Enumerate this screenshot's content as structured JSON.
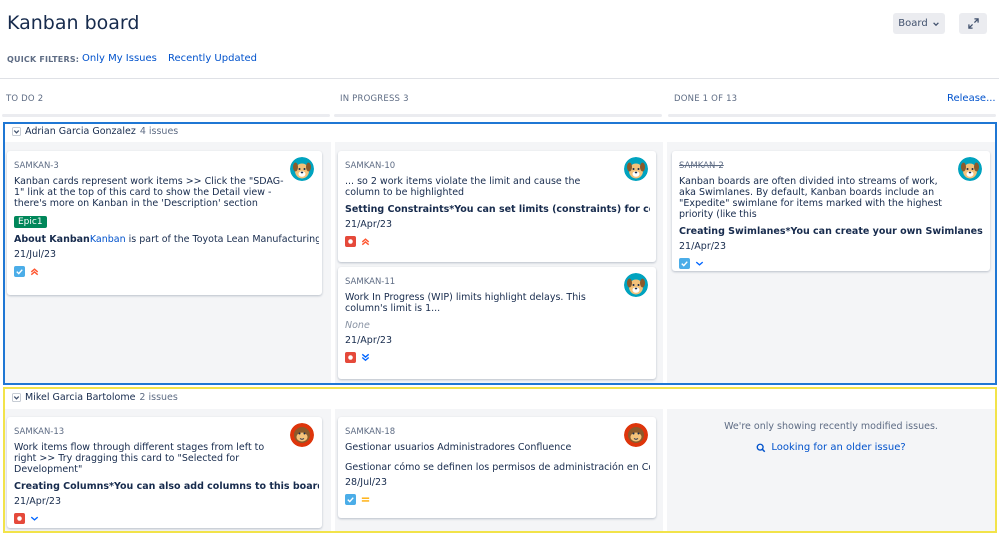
{
  "header": {
    "title": "Kanban board",
    "board_button": "Board",
    "quick_filters_label": "QUICK FILTERS:",
    "quick_filters": [
      "Only My Issues",
      "Recently Updated"
    ]
  },
  "columns": [
    {
      "name": "TO DO",
      "count": "2"
    },
    {
      "name": "IN PROGRESS",
      "count": "3"
    },
    {
      "name": "DONE",
      "count": "1 OF 13"
    }
  ],
  "release_link": "Release...",
  "swimlanes": [
    {
      "name": "Adrian Garcia Gonzalez",
      "count": "4 issues",
      "outline_color": "#1f77d4"
    },
    {
      "name": "Mikel Garcia Bartolome",
      "count": "2 issues",
      "outline_color": "#f2e34a"
    }
  ],
  "cards": [
    {
      "key": "SAMKAN-3",
      "summary": "Kanban cards represent work items >> Click the \"SDAG-1\" link at the top of this card to show the Detail view - there's more on Kanban in the 'Description' section",
      "epic": "Epic1",
      "extra_bold": "About Kanban",
      "extra_link": "Kanban",
      "extra_rest": " is part of the Toyota Lean Manufacturing met",
      "date": "21/Jul/23",
      "type_icon": "task-icon",
      "priority_icon": "priority-high-icon"
    },
    {
      "key": "SAMKAN-10",
      "summary": "... so 2 work items violate the limit and cause the column to be highlighted",
      "extra_bold": "Setting Constraints*You can set limits (constraints) for columns c",
      "date": "21/Apr/23",
      "type_icon": "bug-icon",
      "priority_icon": "priority-high-icon"
    },
    {
      "key": "SAMKAN-11",
      "summary": "Work In Progress (WIP) limits highlight delays. This column's limit is 1...",
      "none_text": "None",
      "date": "21/Apr/23",
      "type_icon": "bug-icon",
      "priority_icon": "priority-lowest-icon"
    },
    {
      "key": "SAMKAN-2",
      "summary": "Kanban boards are often divided into streams of work, aka Swimlanes. By default, Kanban boards include an \"Expedite\" swimlane for items marked with the highest priority (like this",
      "extra_bold": "Creating Swimlanes*You can create your own Swimlanes for this",
      "date": "21/Apr/23",
      "type_icon": "task-icon",
      "priority_icon": "priority-low-icon"
    },
    {
      "key": "SAMKAN-13",
      "summary": "Work items flow through different stages from left to right >> Try dragging this card to \"Selected for Development\"",
      "extra_bold": "Creating Columns*You can also add columns to this board by edi",
      "date": "21/Apr/23",
      "type_icon": "bug-icon",
      "priority_icon": "priority-low-icon"
    },
    {
      "key": "SAMKAN-18",
      "summary": "Gestionar usuarios Administradores Confluence",
      "extra_plain": "Gestionar cómo se definen los permisos de administración en Conflu",
      "date": "28/Jul/23",
      "type_icon": "task-icon",
      "priority_icon": "priority-medium-icon"
    }
  ],
  "done_lane2": {
    "message": "We're only showing recently modified issues.",
    "link": "Looking for an older issue?"
  },
  "colors": {
    "link": "#0052cc",
    "epic": "#00875a",
    "column_bg": "#f4f5f7"
  }
}
